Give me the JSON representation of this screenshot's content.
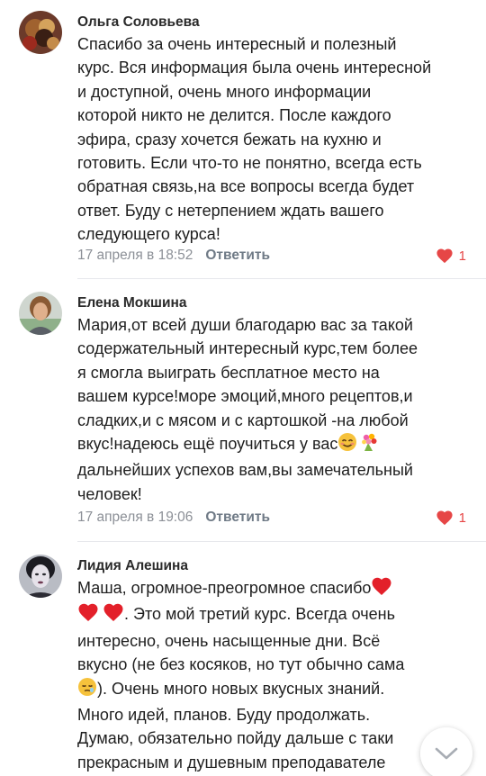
{
  "comments": [
    {
      "author": "Ольга Соловьева",
      "lines": [
        "Спасибо за очень интересный и полезный",
        "курс. Вся информация была очень интересной",
        "и доступной, очень много информации",
        "которой никто не делится. После каждого",
        "эфира, сразу хочется бежать на кухню и",
        "готовить. Если что-то не понятно, всегда есть",
        "обратная связь,на все вопросы всегда будет",
        "ответ. Буду с нетерпением ждать вашего",
        "следующего курса!"
      ],
      "timestamp": "17 апреля в 18:52",
      "reply_label": "Ответить",
      "likes": "1",
      "avatar_icon": "avatar-photo-icon"
    },
    {
      "author": "Елена Мокшина",
      "lines": [
        "Мария,от всей души благодарю вас за такой",
        "содержательный интересный курс,тем более",
        "я смогла выиграть бесплатное место на",
        "вашем курсе!море эмоций,много рецептов,и",
        "сладких,и с мясом и с картошкой -на любой",
        "вкус!надеюсь ещё поучиться у вас",
        "дальнейших успехов вам,вы замечательный",
        "человек!"
      ],
      "timestamp": "17 апреля в 19:06",
      "reply_label": "Ответить",
      "likes": "1",
      "avatar_icon": "avatar-photo-icon"
    },
    {
      "author": "Лидия Алешина",
      "lines": [
        "Маша, огромное-преогромное спасибо",
        ". Это мой третий курс. Всегда очень",
        "интересно, очень насыщенные дни. Всё",
        "вкусно (не без косяков, но тут обычно сама",
        "). Очень много новых вкусных знаний.",
        "Много идей, планов. Буду продолжать.",
        "Думаю, обязательно пойду дальше с таки",
        "прекрасным и душевным преподавателе"
      ],
      "avatar_icon": "avatar-photo-icon"
    }
  ],
  "icons": {
    "like": "heart-icon",
    "scroll": "chevron-down-icon",
    "emoji_smile": "smiling-face-emoji-icon",
    "emoji_flowers": "bouquet-emoji-icon",
    "emoji_heart": "red-heart-emoji-icon",
    "emoji_sleepy": "sleepy-face-emoji-icon"
  },
  "colors": {
    "like": "#e64646",
    "meta": "#8c9097",
    "reply": "#6f7a86",
    "divider": "#e7e8ec"
  }
}
